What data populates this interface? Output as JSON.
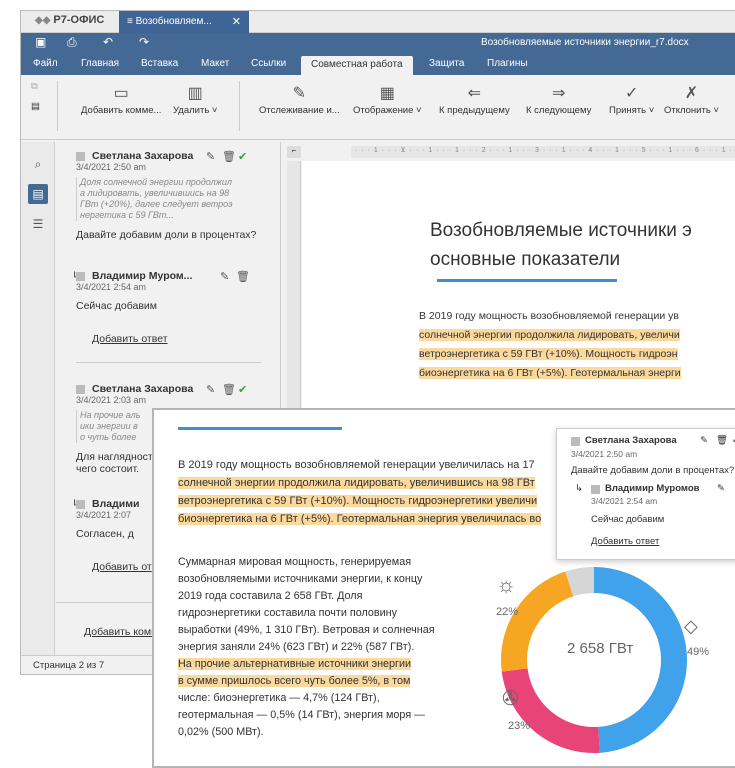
{
  "app": {
    "name": "Р7-ОФИС",
    "tab": "Возобновляем...",
    "close": "✕",
    "doc_title": "Возобновляемые источники энергии_r7.docx"
  },
  "menu": [
    "Файл",
    "Главная",
    "Вставка",
    "Макет",
    "Ссылки",
    "Совместная работа",
    "Защита",
    "Плагины"
  ],
  "ribbon": {
    "add_comment": "Добавить комме...",
    "delete": "Удалить",
    "track": "Отслеживание и...",
    "display": "Отображение",
    "prev": "К предыдущему",
    "next": "К следующему",
    "accept": "Принять",
    "reject": "Отклонить"
  },
  "comments": [
    {
      "author": "Светлана Захарова",
      "date": "3/4/2021 2:50 am",
      "quote": [
        "Доля солнечной энергии продолжил",
        "а лидировать, увеличившись на 98",
        "ГВт (+20%), далее следует ветроэ",
        "нергетика с 59 ГВт..."
      ],
      "text": "Давайте добавим доли в процентах?",
      "reply_author": "Владимир Муром...",
      "reply_date": "3/4/2021 2:54 am",
      "reply_text": "Сейчас добавим",
      "add_reply": "Добавить ответ"
    },
    {
      "author": "Светлана Захарова",
      "date": "3/4/2021 2:03 am",
      "quote": [
        "На прочие аль",
        "ики энергии в",
        "о чуть более"
      ],
      "text": [
        "Для наглядност",
        "чего состоит."
      ],
      "reply_author": "Владими",
      "reply_date": "3/4/2021 2:07",
      "reply_text": "Согласен, д",
      "add_reply": "Добавить от"
    }
  ],
  "add_comment": "Добавить комм",
  "status": "Страница 2 из 7",
  "ruler_marks": "· · · 1 · · · ⊻ · · · 1 · · · 1 · · · 2 · · · 1 · · · 3 · · · 1 · · · 4 · · · 1 · · · 5 · · · 1 · · · 6 · · · 1 · · · 7 · · · 1 · · · 8 · · · 1 · · · 9 · · ·",
  "doc": {
    "title_l1": "Возобновляемые источники э",
    "title_l2": "основные показатели",
    "p1": "В 2019 году мощность возобновляемой генерации ув",
    "p2": "солнечной энергии продолжила лидировать, увеличи",
    "p3": "ветроэнергетика с 59 ГВт (+10%). Мощность гидроэн",
    "p4": "биоэнергетика на 6 ГВт (+5%). Геотермальная энерги"
  },
  "zoom": {
    "z1": "В 2019 году мощность возобновляемой генерации увеличилась на 17",
    "z2": "солнечной энергии продолжила лидировать, увеличившись на 98 ГВт",
    "z3": "ветроэнергетика с 59 ГВт (+10%). Мощность гидроэнергетики увеличи",
    "z4": "биоэнергетика на 6 ГВт (+5%). Геотермальная энергия увеличилась во",
    "lines": [
      "Суммарная мировая мощность, генерируемая",
      "возобновляемыми источниками энергии, к концу",
      "2019 года составила 2 658 ГВт.  Доля",
      "гидроэнергетики составила почти половину",
      "выработки (49%, 1 310 ГВт). Ветровая и солнечная",
      "энергия заняли 24% (623 ГВт) и 22% (587 ГВт)."
    ],
    "hl_lines": [
      "На прочие альтернативные источники энергии",
      "в сумме пришлось всего чуть более 5%, в том"
    ],
    "tail": [
      "числе: биоэнергетика — 4,7% (124 ГВт),",
      "геотермальная — 0,5% (14 ГВт), энергия моря —",
      "0,02% (500 МВт)."
    ]
  },
  "popup": {
    "author": "Светлана Захарова",
    "date": "3/4/2021 2:50 am",
    "text": "Давайте добавим доли в процентах?",
    "reply_author": "Владимир Муромов",
    "reply_date": "3/4/2021 2:54 am",
    "reply_text": "Сейчас добавим",
    "add_reply": "Добавить ответ"
  },
  "chart_data": {
    "type": "pie",
    "center_label": "2 658 ГВт",
    "slices": [
      {
        "label": "49%",
        "value": 49,
        "color": "#3fa2ea"
      },
      {
        "label": "",
        "value": 24,
        "color": "#e94477"
      },
      {
        "label": "",
        "value": 22,
        "color": "#f6a623"
      },
      {
        "label": "",
        "value": 5,
        "color": "#d6d6d6"
      }
    ],
    "labels": {
      "solar": "22%",
      "wind": "23%",
      "hydro": "49%"
    }
  }
}
